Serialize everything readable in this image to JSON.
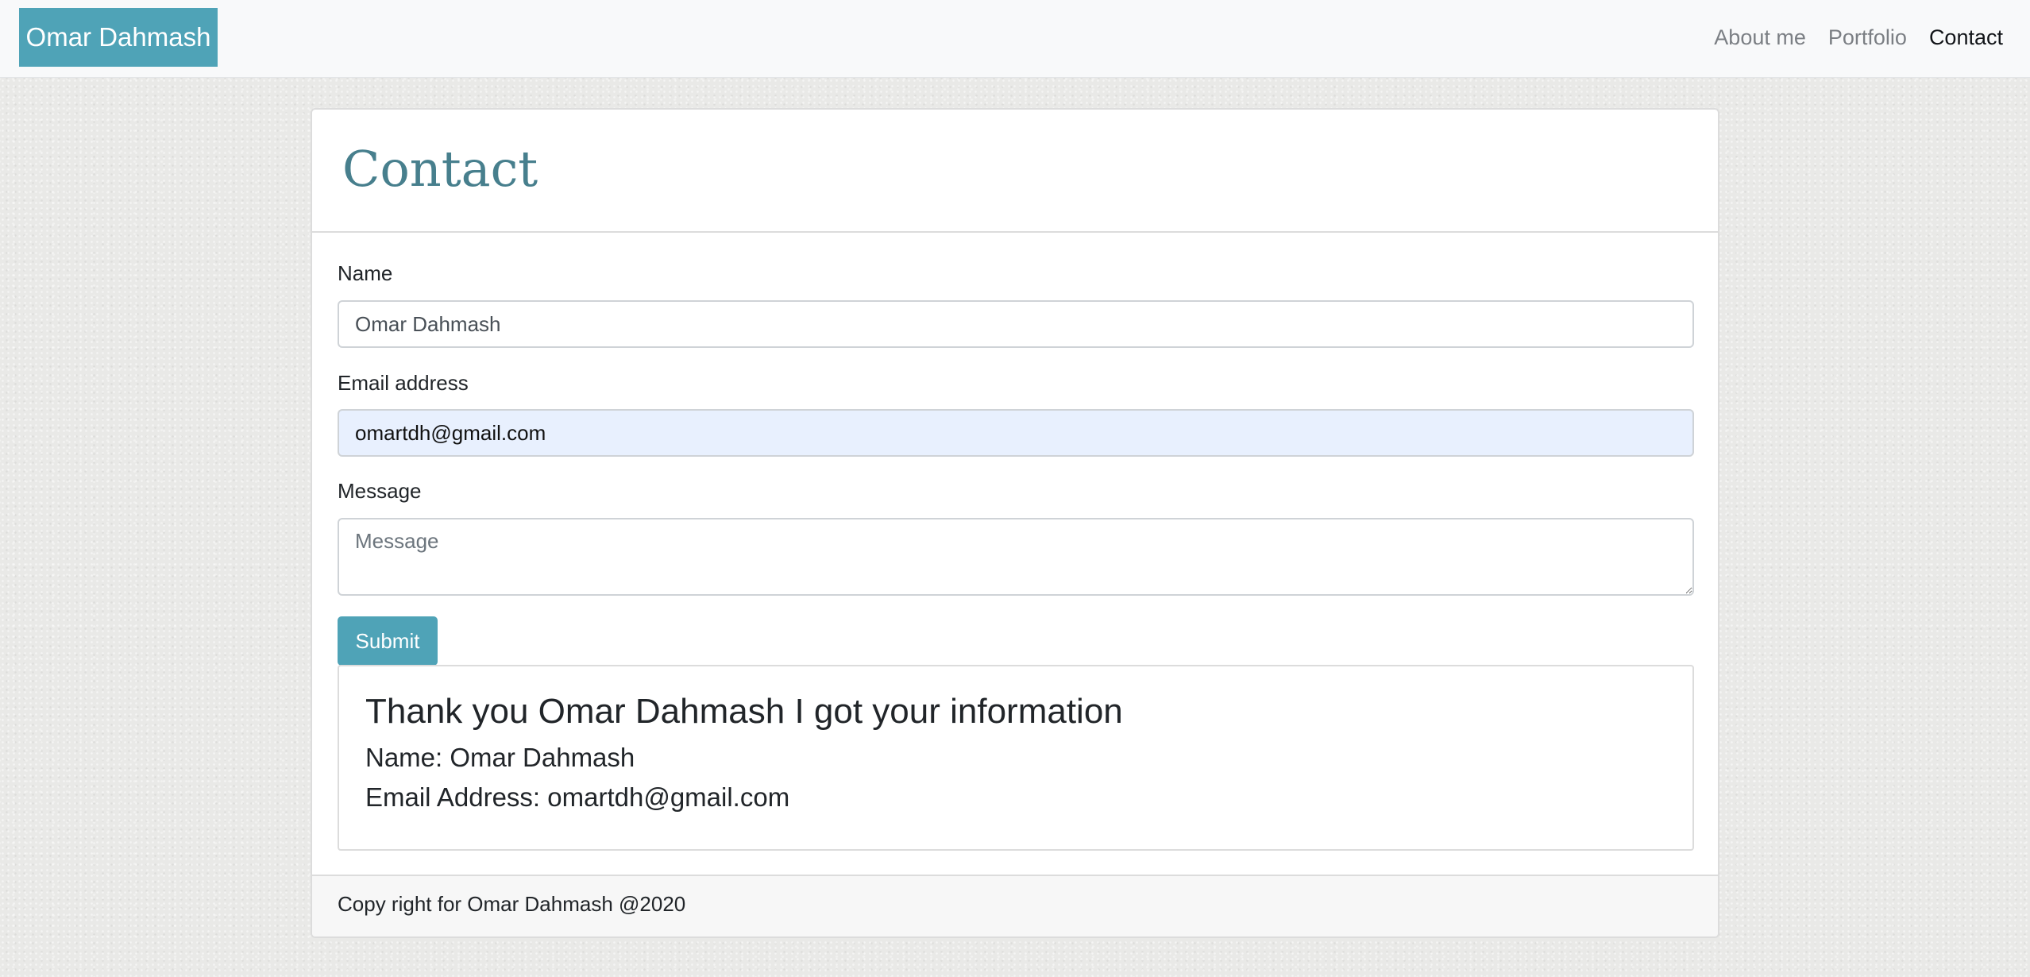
{
  "navbar": {
    "brand": "Omar Dahmash",
    "links": [
      "About me",
      "Portfolio",
      "Contact"
    ],
    "active": "Contact"
  },
  "page": {
    "title": "Contact"
  },
  "form": {
    "name_label": "Name",
    "name_value": "Omar Dahmash",
    "email_label": "Email address",
    "email_value": "omartdh@gmail.com",
    "message_label": "Message",
    "message_placeholder": "Message",
    "message_value": "",
    "submit_label": "Submit"
  },
  "result": {
    "thanks": "Thank you Omar Dahmash I got your information",
    "name_line": "Name: Omar Dahmash",
    "email_line": "Email Address: omartdh@gmail.com"
  },
  "footer": {
    "text": "Copy right for Omar Dahmash @2020"
  },
  "colors": {
    "brand_bg": "#4fa3b7",
    "title": "#477f8d",
    "autofill_bg": "#e8f0fe"
  }
}
